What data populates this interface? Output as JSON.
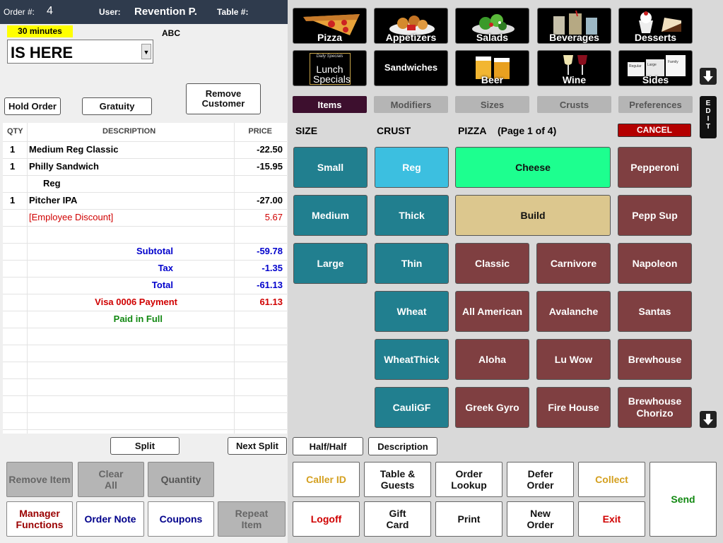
{
  "header": {
    "order_label": "Order #:",
    "order_number": "4",
    "user_label": "User:",
    "user_name": "Revention P.",
    "table_label": "Table #:"
  },
  "order_info": {
    "timer_badge": "30 minutes",
    "customer_code": "ABC",
    "status_value": "IS HERE"
  },
  "order_actions": {
    "hold_order": "Hold Order",
    "gratuity": "Gratuity",
    "remove_customer": "Remove Customer"
  },
  "order_table": {
    "headers": {
      "qty": "QTY",
      "description": "DESCRIPTION",
      "price": "PRICE"
    },
    "rows": [
      {
        "qty": "1",
        "desc": "Medium Reg Classic",
        "price": "-22.50"
      },
      {
        "qty": "1",
        "desc": "Philly Sandwich",
        "price": "-15.95"
      },
      {
        "qty": "",
        "desc": "Reg",
        "price": ""
      },
      {
        "qty": "1",
        "desc": "Pitcher IPA",
        "price": "-27.00"
      },
      {
        "qty": "",
        "desc": "[Employee Discount]",
        "price": "5.67"
      }
    ],
    "totals": [
      {
        "label": "Subtotal",
        "value": "-59.78"
      },
      {
        "label": "Tax",
        "value": "-1.35"
      },
      {
        "label": "Total",
        "value": "-61.13"
      },
      {
        "label": "Visa 0006 Payment",
        "value": "61.13"
      },
      {
        "label": "Paid in Full",
        "value": ""
      }
    ]
  },
  "split": {
    "split": "Split",
    "next_split": "Next Split"
  },
  "left_buttons": {
    "remove_item": "Remove Item",
    "clear_all": "Clear All",
    "quantity": "Quantity",
    "manager_functions": "Manager Functions",
    "order_note": "Order Note",
    "coupons": "Coupons",
    "repeat_item": "Repeat Item"
  },
  "categories": [
    {
      "label": "Pizza",
      "icon": "pizza-icon"
    },
    {
      "label": "Appetizers",
      "icon": "appetizers-icon"
    },
    {
      "label": "Salads",
      "icon": "salad-icon"
    },
    {
      "label": "Beverages",
      "icon": "beverages-icon"
    },
    {
      "label": "Desserts",
      "icon": "dessert-icon"
    },
    {
      "label": "Lunch Specials",
      "icon": "lunch-specials-icon",
      "sub": "Daily Specials"
    },
    {
      "label": "Sandwiches",
      "icon": "sandwich-icon"
    },
    {
      "label": "Beer",
      "icon": "beer-icon"
    },
    {
      "label": "Wine",
      "icon": "wine-icon"
    },
    {
      "label": "Sides",
      "icon": "sides-icon",
      "sizes": [
        "Regular",
        "Large",
        "Family"
      ]
    }
  ],
  "tabs": [
    "Items",
    "Modifiers",
    "Sizes",
    "Crusts",
    "Preferences"
  ],
  "edit_label": "EDIT",
  "section_headers": {
    "size": "SIZE",
    "crust": "CRUST",
    "pizza": "PIZZA",
    "page": "(Page 1 of 4)"
  },
  "cancel_label": "CANCEL",
  "sizes": [
    "Small",
    "Medium",
    "Large"
  ],
  "crusts": [
    "Reg",
    "Thick",
    "Thin",
    "Wheat",
    "WheatThick",
    "CauliGF"
  ],
  "pizzas": {
    "cheese": "Cheese",
    "build": "Build",
    "pepperoni": "Pepperoni",
    "pepp_sup": "Pepp Sup",
    "grid": [
      [
        "Classic",
        "Carnivore",
        "Napoleon"
      ],
      [
        "All American",
        "Avalanche",
        "Santas"
      ],
      [
        "Aloha",
        "Lu Wow",
        "Brewhouse"
      ],
      [
        "Greek Gyro",
        "Fire House",
        "Brewhouse Chorizo"
      ]
    ]
  },
  "half_half": "Half/Half",
  "description": "Description",
  "bottom_buttons": {
    "caller_id": "Caller ID",
    "table_guests": "Table & Guests",
    "order_lookup": "Order Lookup",
    "defer_order": "Defer Order",
    "collect": "Collect",
    "send": "Send",
    "logoff": "Logoff",
    "gift_card": "Gift Card",
    "print": "Print",
    "new_order": "New Order",
    "exit": "Exit"
  },
  "colors": {
    "header_bg": "#2f3b4d",
    "teal": "#217f8f",
    "teal_selected": "#3cbfe0",
    "maroon": "#7f3f41",
    "cheese_green": "#1dff8f",
    "build_tan": "#dcc78e",
    "items_tab": "#3d0f2e",
    "cancel_red": "#b40000"
  }
}
